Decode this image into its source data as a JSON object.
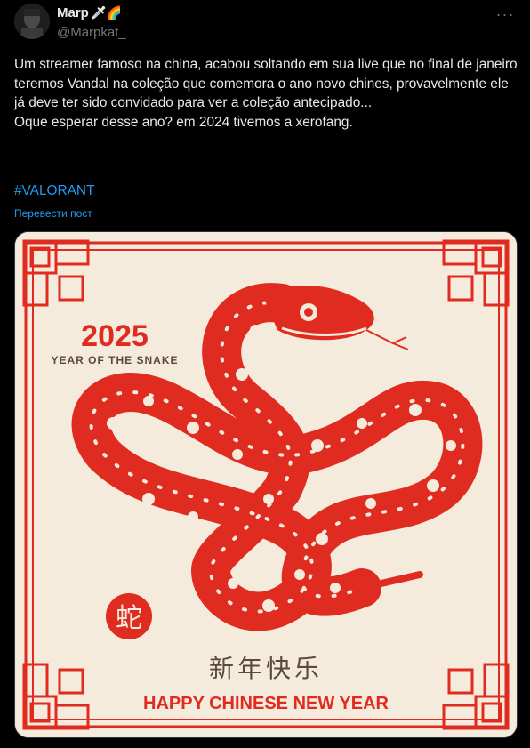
{
  "author": {
    "name": "Marp",
    "emoji": "🗡🌈",
    "handle": "@Marpkat_"
  },
  "post": {
    "text": "Um streamer famoso na china, acabou soltando em sua live que no final de janeiro teremos Vandal na coleção que comemora o ano novo chines, provavelmente ele já deve ter sido convidado para ver a coleção antecipado...\nOque esperar desse ano? em 2024 tivemos a xerofang.",
    "hashtag": "#VALORANT",
    "translate": "Перевести пост"
  },
  "media": {
    "year": "2025",
    "subtitle": "YEAR OF THE SNAKE",
    "seal_char": "蛇",
    "chinese_greeting": "新年快乐",
    "greeting": "HAPPY CHINESE NEW YEAR",
    "colors": {
      "background": "#f5ebdc",
      "red": "#e02b20",
      "text_dark": "#5a4a3a"
    }
  },
  "icons": {
    "more": "more-horizontal-icon"
  }
}
